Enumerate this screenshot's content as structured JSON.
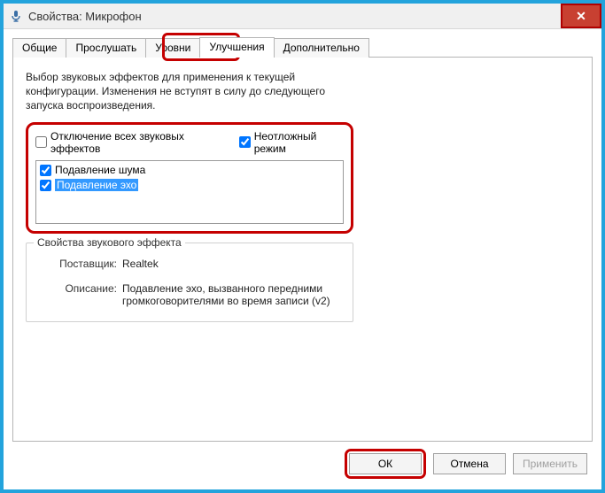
{
  "window": {
    "title": "Свойства: Микрофон",
    "close_glyph": "✕"
  },
  "tabs": {
    "items": [
      {
        "label": "Общие"
      },
      {
        "label": "Прослушать"
      },
      {
        "label": "Уровни"
      },
      {
        "label": "Улучшения"
      },
      {
        "label": "Дополнительно"
      }
    ],
    "active_index": 3
  },
  "panel": {
    "description": "Выбор звуковых эффектов для применения к текущей конфигурации. Изменения не вступят в силу до следующего запуска воспроизведения.",
    "disable_all_label": "Отключение всех звуковых эффектов",
    "disable_all_checked": false,
    "urgent_label": "Неотложный режим",
    "urgent_checked": true,
    "effects": [
      {
        "label": "Подавление шума",
        "checked": true,
        "selected": false
      },
      {
        "label": "Подавление эхо",
        "checked": true,
        "selected": true
      }
    ],
    "group_title": "Свойства звукового эффекта",
    "vendor_label": "Поставщик:",
    "vendor_value": "Realtek",
    "desc_label": "Описание:",
    "desc_value": "Подавление эхо, вызванного передними громкоговорителями во время записи (v2)"
  },
  "buttons": {
    "ok": "ОК",
    "cancel": "Отмена",
    "apply": "Применить"
  }
}
